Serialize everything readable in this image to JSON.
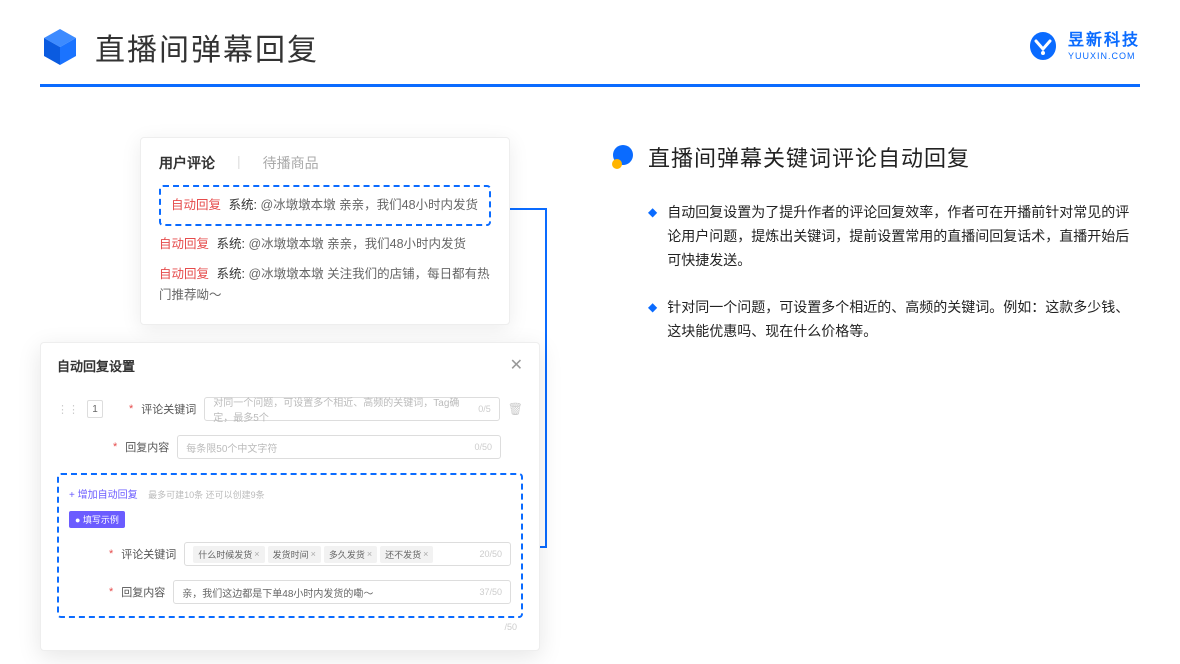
{
  "header": {
    "title": "直播间弹幕回复",
    "brand_cn": "昱新科技",
    "brand_en": "YUUXIN.COM"
  },
  "comments_card": {
    "tab_active": "用户评论",
    "tab_inactive": "待播商品",
    "highlight": {
      "tag": "自动回复",
      "sys": "系统:",
      "text": "@冰墩墩本墩 亲亲，我们48小时内发货"
    },
    "line2": {
      "tag": "自动回复",
      "sys": "系统:",
      "text": "@冰墩墩本墩 亲亲，我们48小时内发货"
    },
    "line3": {
      "tag": "自动回复",
      "sys": "系统:",
      "text": "@冰墩墩本墩 关注我们的店铺，每日都有热门推荐呦～"
    }
  },
  "settings_card": {
    "title": "自动回复设置",
    "num": "1",
    "close": "✕",
    "row1": {
      "label": "评论关键词",
      "placeholder": "对同一个问题，可设置多个相近、高频的关键词，Tag确定，最多5个",
      "count": "0/5"
    },
    "row2": {
      "label": "回复内容",
      "placeholder": "每条限50个中文字符",
      "count": "0/50"
    },
    "add_link": "+ 增加自动回复",
    "add_hint": "最多可建10条 还可以创建9条",
    "example_badge": "● 填写示例",
    "ex_row1": {
      "label": "评论关键词",
      "tags": [
        "什么时候发货",
        "发货时间",
        "多久发货",
        "还不发货"
      ],
      "count": "20/50"
    },
    "ex_row2": {
      "label": "回复内容",
      "text": "亲，我们这边都是下单48小时内发货的嘞～",
      "count": "37/50"
    },
    "footer_count": "/50"
  },
  "right_panel": {
    "section_title": "直播间弹幕关键词评论自动回复",
    "bullet1": "自动回复设置为了提升作者的评论回复效率，作者可在开播前针对常见的评论用户问题，提炼出关键词，提前设置常用的直播间回复话术，直播开始后可快捷发送。",
    "bullet2": "针对同一个问题，可设置多个相近的、高频的关键词。例如：这款多少钱、这块能优惠吗、现在什么价格等。"
  }
}
